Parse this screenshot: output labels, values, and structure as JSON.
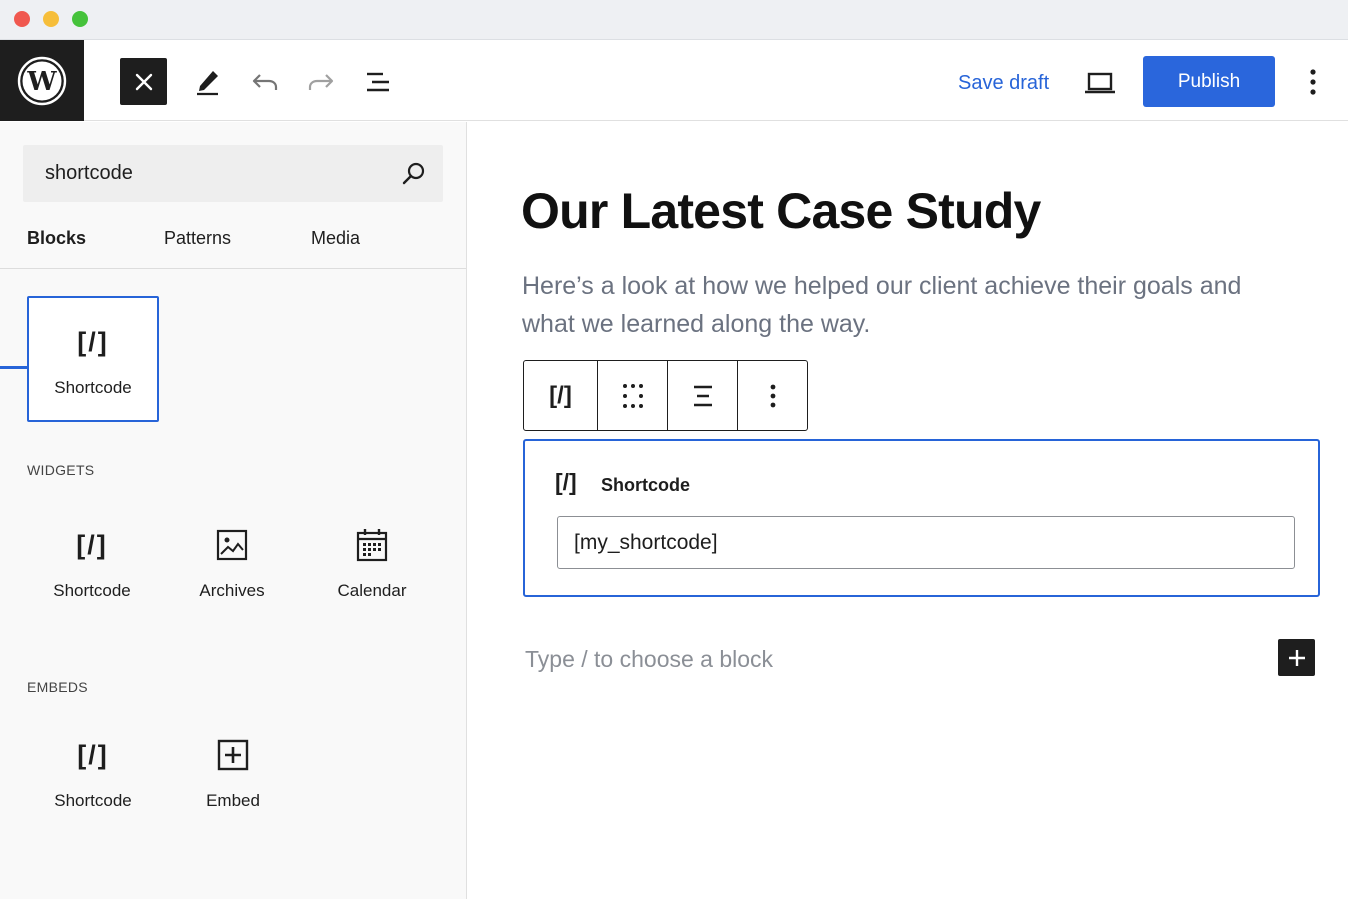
{
  "toolbar": {
    "save_draft_label": "Save draft",
    "publish_label": "Publish"
  },
  "inserter": {
    "search": {
      "value": "shortcode"
    },
    "tabs": [
      {
        "label": "Blocks",
        "active": true
      },
      {
        "label": "Patterns",
        "active": false
      },
      {
        "label": "Media",
        "active": false
      }
    ],
    "top_result": {
      "icon": "[/]",
      "label": "Shortcode"
    },
    "sections": [
      {
        "title": "WIDGETS",
        "items": [
          {
            "icon": "[/]",
            "label": "Shortcode"
          },
          {
            "icon": "archives-icon",
            "label": "Archives"
          },
          {
            "icon": "calendar-icon",
            "label": "Calendar"
          }
        ]
      },
      {
        "title": "EMBEDS",
        "items": [
          {
            "icon": "[/]",
            "label": "Shortcode"
          },
          {
            "icon": "embed-plus-icon",
            "label": "Embed"
          }
        ]
      }
    ]
  },
  "editor": {
    "title": "Our Latest Case Study",
    "excerpt": "Here’s a look at how we helped our client achieve their goals and what we learned along the way.",
    "block_toolbar": {
      "type_icon": "[/]"
    },
    "shortcode_block": {
      "icon": "[/]",
      "label": "Shortcode",
      "value": "[my_shortcode]"
    },
    "appender_placeholder": "Type / to choose a block"
  },
  "colors": {
    "accent": "#2764d8",
    "publish_bg": "#2a66dc",
    "dark": "#1e1e1e",
    "muted_text": "#6b7280"
  }
}
